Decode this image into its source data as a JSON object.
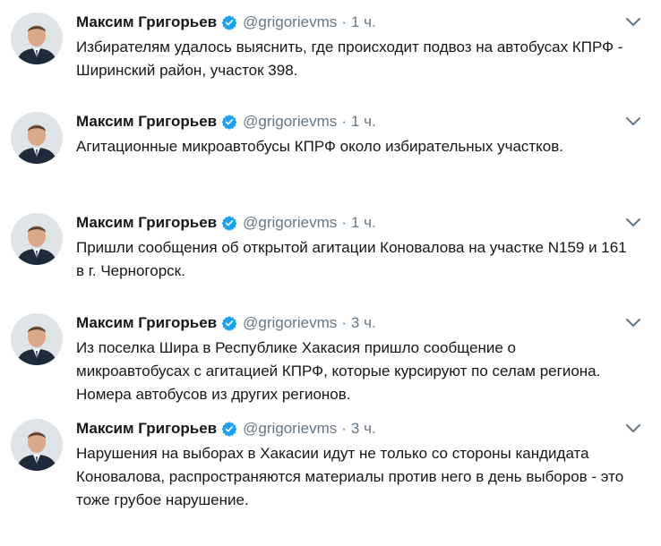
{
  "colors": {
    "name": "#14171a",
    "meta": "#657786",
    "verified": "#1da1f2",
    "caret": "#657786"
  },
  "tweets": [
    {
      "author": "Максим Григорьев",
      "handle": "@grigorievms",
      "separator": "·",
      "time": "1 ч.",
      "text": "Избирателям удалось выяснить, где происходит подвоз на автобусах КПРФ -\nШиринский район, участок 398."
    },
    {
      "author": "Максим Григорьев",
      "handle": "@grigorievms",
      "separator": "·",
      "time": "1 ч.",
      "text": "Агитационные микроавтобусы КПРФ около избирательных участков."
    },
    {
      "author": "Максим Григорьев",
      "handle": "@grigorievms",
      "separator": "·",
      "time": "1 ч.",
      "text": "Пришли сообщения об открытой агитации Коновалова на участке N159 и 161\nв г. Черногорск."
    },
    {
      "author": "Максим Григорьев",
      "handle": "@grigorievms",
      "separator": "·",
      "time": "3 ч.",
      "text": "Из поселка Шира в Республике Хакасия пришло сообщение о\nмикроавтобусах с агитацией КПРФ, которые курсируют по селам региона.\nНомера автобусов из других регионов."
    },
    {
      "author": "Максим Григорьев",
      "handle": "@grigorievms",
      "separator": "·",
      "time": "3 ч.",
      "text": "Нарушения на выборах в Хакасии идут не только со стороны кандидата\nКоновалова, распространяются материалы против него в день выборов - это\nтоже грубое нарушение."
    }
  ]
}
